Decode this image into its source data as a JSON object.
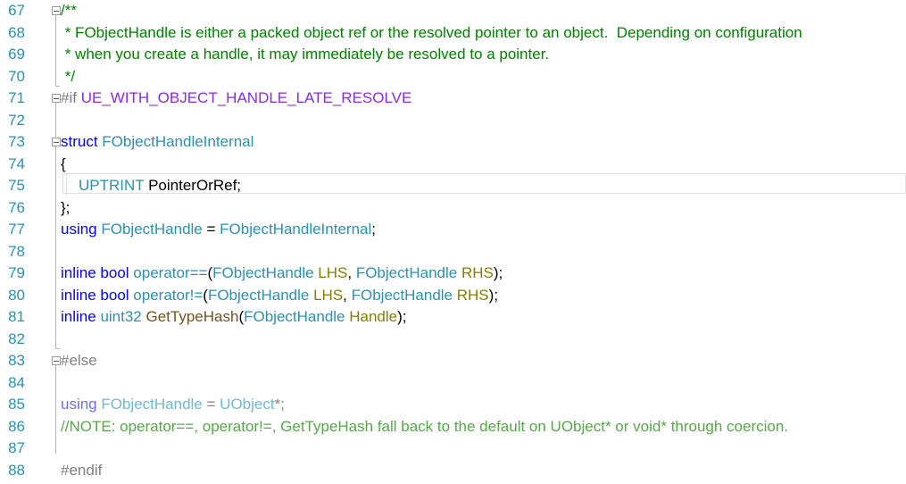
{
  "editor": {
    "lines": [
      {
        "n": "67"
      },
      {
        "n": "68"
      },
      {
        "n": "69"
      },
      {
        "n": "70"
      },
      {
        "n": "71"
      },
      {
        "n": "72"
      },
      {
        "n": "73"
      },
      {
        "n": "74"
      },
      {
        "n": "75"
      },
      {
        "n": "76"
      },
      {
        "n": "77"
      },
      {
        "n": "78"
      },
      {
        "n": "79"
      },
      {
        "n": "80"
      },
      {
        "n": "81"
      },
      {
        "n": "82"
      },
      {
        "n": "83"
      },
      {
        "n": "84"
      },
      {
        "n": "85"
      },
      {
        "n": "86"
      },
      {
        "n": "87"
      },
      {
        "n": "88"
      }
    ],
    "code": {
      "l67": "/**",
      "l68": " * FObjectHandle is either a packed object ref or the resolved pointer to an object.  Depending on configuration",
      "l69": " * when you create a handle, it may immediately be resolved to a pointer.",
      "l70": " */",
      "l71_pp": "#if",
      "l71_macro": "UE_WITH_OBJECT_HANDLE_LATE_RESOLVE",
      "l73_kw": "struct",
      "l73_type": "FObjectHandleInternal",
      "l74": "{",
      "l75_type": "UPTRINT",
      "l75_name": "PointerOrRef;",
      "l76": "};",
      "l77_kw": "using",
      "l77_type1": "FObjectHandle",
      "l77_eq": "=",
      "l77_type2": "FObjectHandleInternal",
      "l77_end": ";",
      "l79_kw": "inline bool",
      "l79_op": "operator==",
      "l79_p1": "(",
      "l79_t1": "FObjectHandle",
      "l79_a1": "LHS",
      "l79_c": ",",
      "l79_t2": "FObjectHandle",
      "l79_a2": "RHS",
      "l79_end": ");",
      "l80_kw": "inline bool",
      "l80_op": "operator!=",
      "l80_p1": "(",
      "l80_t1": "FObjectHandle",
      "l80_a1": "LHS",
      "l80_c": ",",
      "l80_t2": "FObjectHandle",
      "l80_a2": "RHS",
      "l80_end": ");",
      "l81_kw": "inline",
      "l81_type": "uint32",
      "l81_fn": "GetTypeHash",
      "l81_p1": "(",
      "l81_t1": "FObjectHandle",
      "l81_a1": "Handle",
      "l81_end": ");",
      "l83_pp": "#else",
      "l85_kw": "using",
      "l85_type1": "FObjectHandle",
      "l85_eq": "=",
      "l85_type2": "UObject",
      "l85_end": "*;",
      "l86": "//NOTE: operator==, operator!=, GetTypeHash fall back to the default on UObject* or void* through coercion.",
      "l88_pp": "#endif"
    }
  },
  "colors": {
    "line_number": "#2b91af",
    "comment": "#008000",
    "keyword": "#0000ff",
    "type": "#2b91af",
    "macro": "#8a2be2",
    "function": "#74531f",
    "parameter": "#808000",
    "preprocessor": "#808080"
  }
}
